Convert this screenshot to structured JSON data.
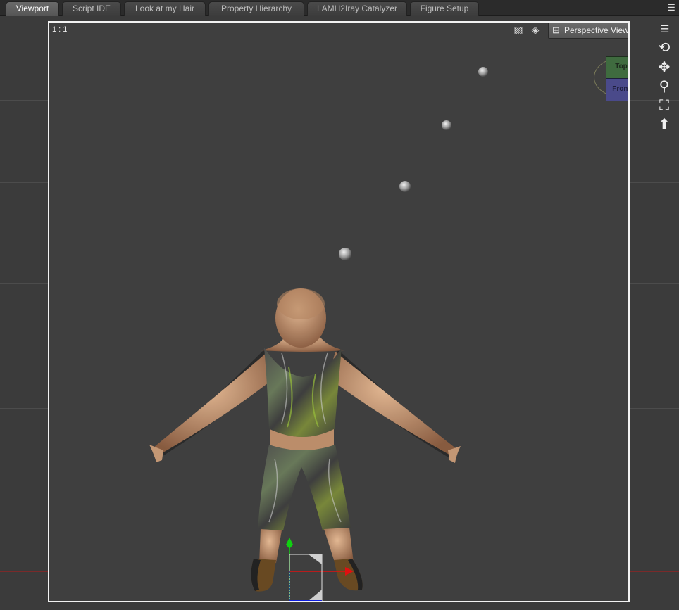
{
  "tabs": [
    {
      "label": "Viewport",
      "active": true
    },
    {
      "label": "Script IDE",
      "active": false
    },
    {
      "label": "Look at my Hair",
      "active": false
    },
    {
      "label": "Property Hierarchy",
      "active": false
    },
    {
      "label": "LAMH2Iray Catalyzer",
      "active": false
    },
    {
      "label": "Figure Setup",
      "active": false
    }
  ],
  "viewport": {
    "ratio_label": "1 : 1",
    "view_select": {
      "value": "Perspective View",
      "icon": "pane-layout-icon"
    },
    "view_cube": {
      "top_label": "Top",
      "front_label": "Front",
      "top_color": "#3f6b3f",
      "front_color": "#4a4a8a"
    },
    "overlay_icons": [
      "draw-style-icon",
      "camera-icon"
    ]
  },
  "nav_tools": [
    "orbit-icon",
    "pan-icon",
    "zoom-icon",
    "frame-icon",
    "reset-view-icon"
  ],
  "colors": {
    "background": "#3f3f3f",
    "frame": "#f2f2f2",
    "gizmo_x": "#e01010",
    "gizmo_y": "#10d010",
    "gizmo_z": "#1020e0"
  }
}
